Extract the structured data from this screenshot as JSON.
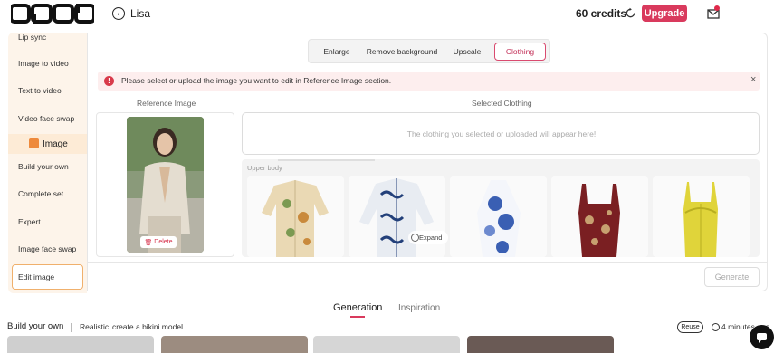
{
  "header": {
    "logo_text": "opob",
    "user_name": "Lisa",
    "credits": "60 credits",
    "upgrade_label": "Upgrade"
  },
  "sidebar": {
    "items_top": [
      {
        "label": "Lip sync"
      },
      {
        "label": "Image to video"
      },
      {
        "label": "Text to video"
      },
      {
        "label": "Video face swap"
      }
    ],
    "section_label": "Image",
    "items_bottom": [
      {
        "label": "Build your own"
      },
      {
        "label": "Complete set"
      },
      {
        "label": "Expert"
      },
      {
        "label": "Image face swap"
      },
      {
        "label": "Edit image"
      }
    ]
  },
  "tabs": [
    {
      "label": "Enlarge"
    },
    {
      "label": "Remove background"
    },
    {
      "label": "Upscale"
    },
    {
      "label": "Clothing",
      "active": true
    }
  ],
  "alert": {
    "message": "Please select or upload the image you want to edit in Reference Image section."
  },
  "reference": {
    "label": "Reference Image",
    "delete_label": "Delete"
  },
  "selected_clothing": {
    "label": "Selected Clothing",
    "placeholder": "The clothing you selected or uploaded will appear here!"
  },
  "clothing": {
    "category": "Upper body",
    "expand_label": "Expand",
    "items": [
      {
        "name": "floral-shirt"
      },
      {
        "name": "blue-toile-shirt"
      },
      {
        "name": "blue-floral-halter"
      },
      {
        "name": "red-floral-top"
      },
      {
        "name": "yellow-lace-corset"
      }
    ]
  },
  "generate_label": "Generate",
  "bottom": {
    "tabs": [
      {
        "label": "Generation",
        "active": true
      },
      {
        "label": "Inspiration"
      }
    ],
    "mode": "Build your own",
    "style": "Realistic",
    "prompt": "create a bikini model",
    "reuse_label": "Reuse",
    "time": "4 minutes ago"
  },
  "colors": {
    "accent": "#d93a5d",
    "sidebar_bg": "#fdf4ea",
    "alert_bg": "#fdeeee"
  }
}
